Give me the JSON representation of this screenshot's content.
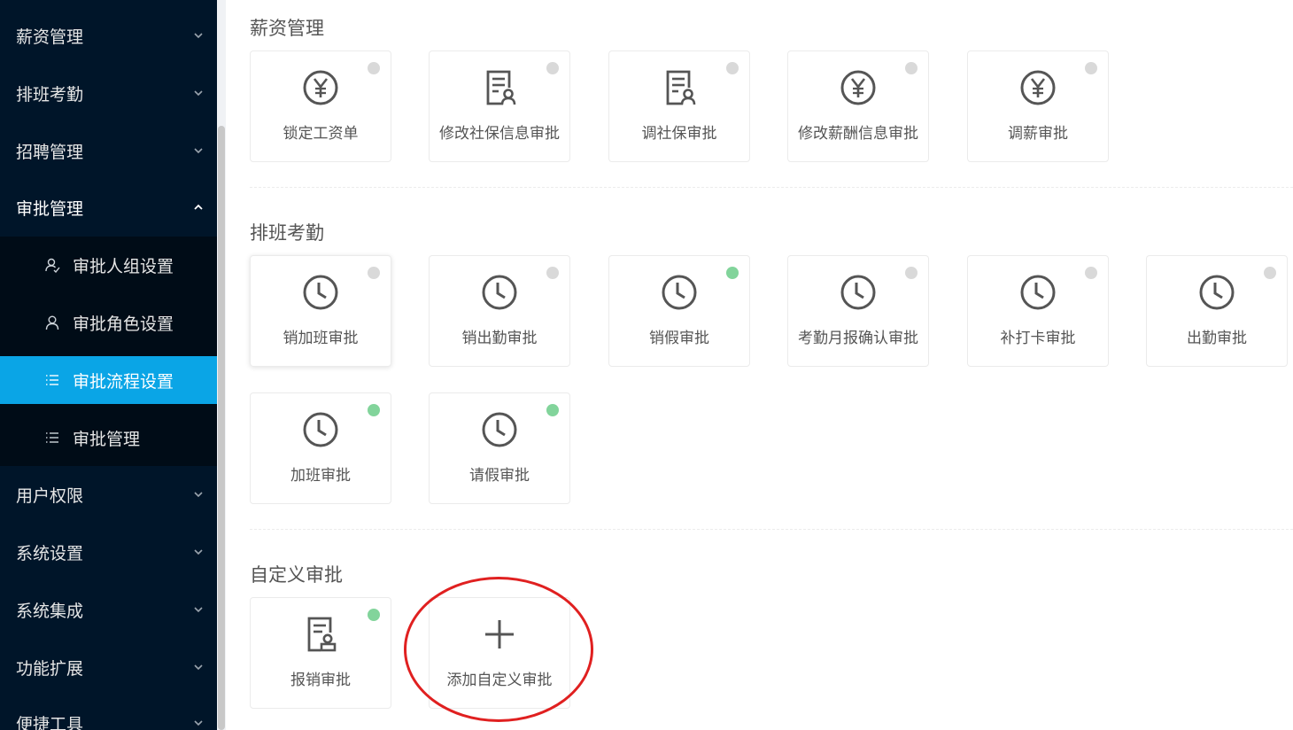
{
  "sidebar": {
    "menu": [
      {
        "label": "薪资管理"
      },
      {
        "label": "排班考勤"
      },
      {
        "label": "招聘管理"
      },
      {
        "label": "审批管理"
      },
      {
        "label": "用户权限"
      },
      {
        "label": "系统设置"
      },
      {
        "label": "系统集成"
      },
      {
        "label": "功能扩展"
      },
      {
        "label": "便捷工具"
      }
    ],
    "submenu": [
      {
        "label": "审批人组设置",
        "icon": "user-group-icon"
      },
      {
        "label": "审批角色设置",
        "icon": "user-icon"
      },
      {
        "label": "审批流程设置",
        "icon": "list-icon",
        "active": true
      },
      {
        "label": "审批管理",
        "icon": "list-icon"
      }
    ]
  },
  "colors": {
    "sidebar_bg": "#001529",
    "submenu_bg": "#000c17",
    "active": "#0aa5e6",
    "status_on": "#82d49b",
    "status_off": "#d9d9d9",
    "highlight": "#e02020"
  },
  "sections": {
    "salary": {
      "title": "薪资管理",
      "cards": [
        {
          "label": "锁定工资单",
          "icon": "yuan-icon",
          "enabled": false
        },
        {
          "label": "修改社保信息审批",
          "icon": "document-user-icon",
          "enabled": false
        },
        {
          "label": "调社保审批",
          "icon": "document-user-icon",
          "enabled": false
        },
        {
          "label": "修改薪酬信息审批",
          "icon": "yuan-icon",
          "enabled": false
        },
        {
          "label": "调薪审批",
          "icon": "yuan-icon",
          "enabled": false
        }
      ]
    },
    "attendance": {
      "title": "排班考勤",
      "cards": [
        {
          "label": "销加班审批",
          "icon": "clock-icon",
          "enabled": false
        },
        {
          "label": "销出勤审批",
          "icon": "clock-icon",
          "enabled": false
        },
        {
          "label": "销假审批",
          "icon": "clock-icon",
          "enabled": true
        },
        {
          "label": "考勤月报确认审批",
          "icon": "clock-icon",
          "enabled": false
        },
        {
          "label": "补打卡审批",
          "icon": "clock-icon",
          "enabled": false
        },
        {
          "label": "出勤审批",
          "icon": "clock-icon",
          "enabled": false
        },
        {
          "label": "加班审批",
          "icon": "clock-icon",
          "enabled": true
        },
        {
          "label": "请假审批",
          "icon": "clock-icon",
          "enabled": true
        }
      ]
    },
    "custom": {
      "title": "自定义审批",
      "cards": [
        {
          "label": "报销审批",
          "icon": "document-stamp-icon",
          "enabled": true
        }
      ],
      "add_label": "添加自定义审批"
    }
  }
}
